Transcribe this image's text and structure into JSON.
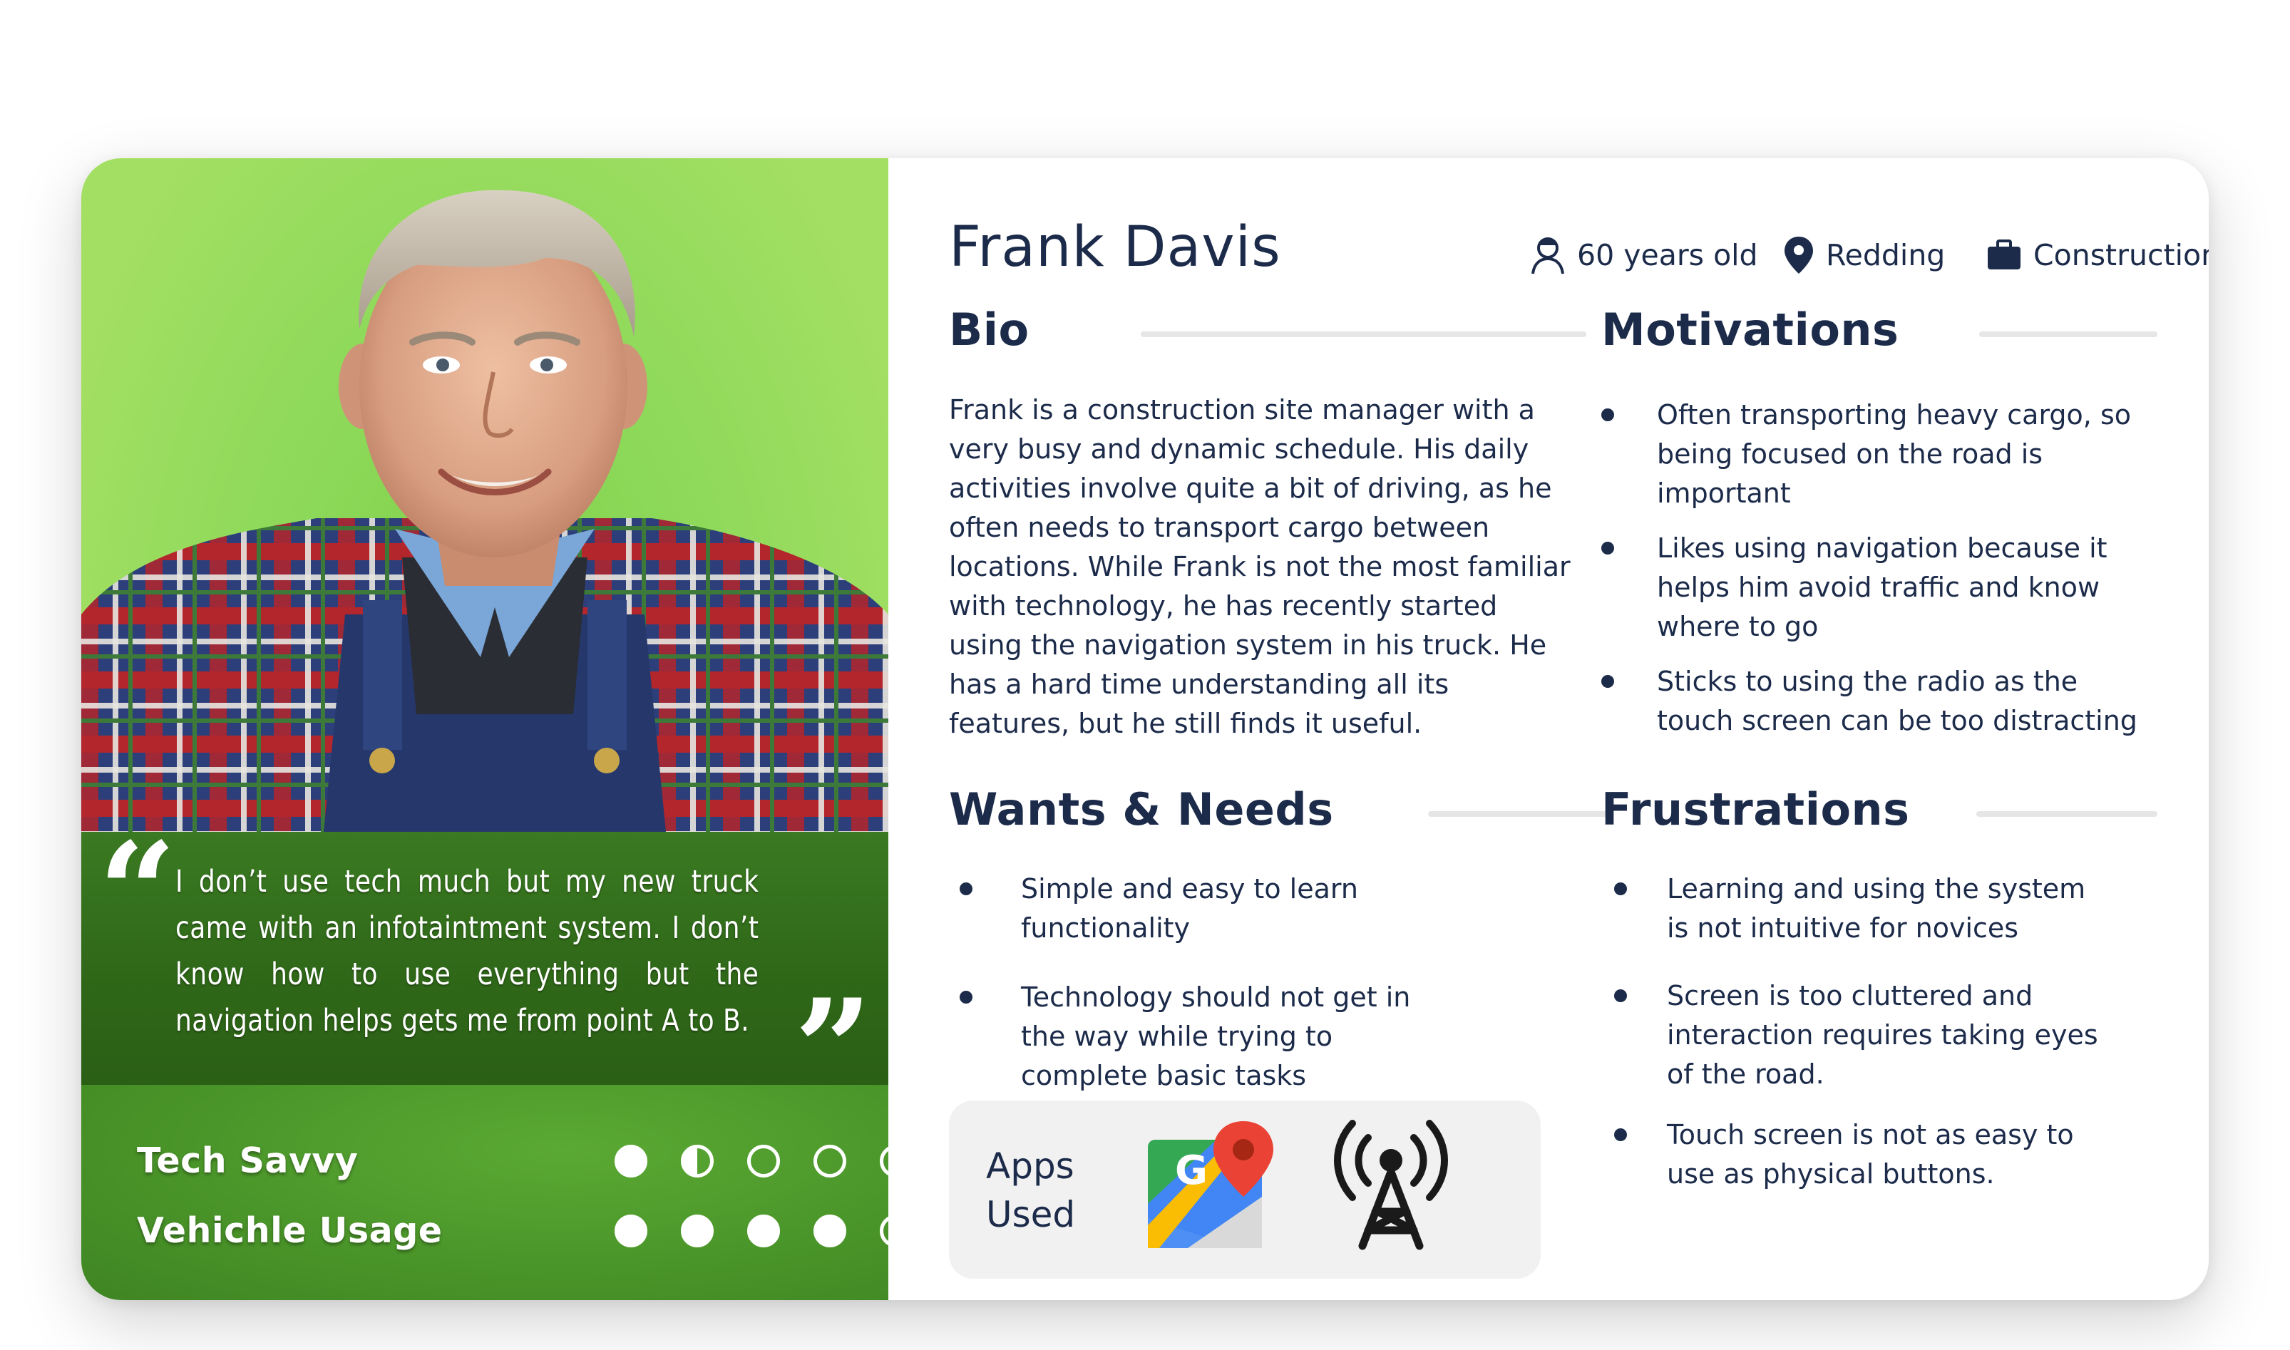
{
  "persona": {
    "name": "Frank Davis",
    "age": "60 years old",
    "location": "Redding",
    "occupation": "Construction"
  },
  "quote": "I don’t use tech much but my new truck came with an infotaintment system. I don’t know how to use everything but the navigation helps gets me from point A to B.",
  "ratings": [
    {
      "label": "Tech Savvy",
      "level": 1.5,
      "max": 5
    },
    {
      "label": "Vehichle Usage",
      "level": 4,
      "max": 5
    }
  ],
  "bio": {
    "title": "Bio",
    "text": "Frank is a construction site manager with a very busy and dynamic schedule. His daily activities involve quite a bit of driving, as he often needs to transport cargo between locations. While Frank is not the most familiar with technology, he has recently started using the navigation system in his truck. He has a hard time understanding all its features, but he still finds it useful."
  },
  "motivations": {
    "title": "Motivations",
    "items": [
      "Often transporting heavy cargo, so being focused on the road is important",
      "Likes using navigation because it helps him avoid traffic and know where to go",
      "Sticks to using the radio as the touch screen can be too distracting"
    ]
  },
  "wants": {
    "title": "Wants & Needs",
    "items": [
      "Simple and easy to learn functionality",
      "Technology should not get in the way while trying to complete basic tasks"
    ]
  },
  "frustrations": {
    "title": "Frustrations",
    "items": [
      "Learning and using the system is not intuitive for novices",
      "Screen is too cluttered and interaction requires taking eyes of the road.",
      "Touch screen is not as easy to use as physical buttons."
    ]
  },
  "apps": {
    "label_line1": "Apps",
    "label_line2": "Used",
    "icons": [
      "google-maps-icon",
      "radio-tower-icon"
    ]
  },
  "colors": {
    "navy": "#1c2b4a",
    "green_dark": "#2f6718",
    "green_mid": "#4a9529",
    "green_light": "#a3df63"
  }
}
